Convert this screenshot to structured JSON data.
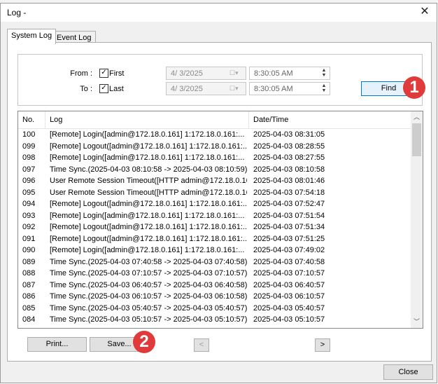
{
  "window": {
    "title": "Log -"
  },
  "tabs": [
    {
      "label": "System Log"
    },
    {
      "label": "Event Log"
    }
  ],
  "filter": {
    "from_label": "From :",
    "to_label": "To :",
    "first_label": "First",
    "last_label": "Last",
    "first_checked": true,
    "last_checked": true,
    "from_date": "4/  3/2025",
    "to_date": "4/  3/2025",
    "from_time": "8:30:05 AM",
    "to_time": "8:30:05 AM",
    "find_label": "Find"
  },
  "table": {
    "columns": [
      "No.",
      "Log",
      "Date/Time"
    ],
    "rows": [
      {
        "no": "100",
        "log": "[Remote] Login([admin@172.18.0.161] 1:172.18.0.161:...",
        "dt": "2025-04-03 08:31:05"
      },
      {
        "no": "099",
        "log": "[Remote] Logout([admin@172.18.0.161] 1:172.18.0.161:...",
        "dt": "2025-04-03 08:28:55"
      },
      {
        "no": "098",
        "log": "[Remote] Login([admin@172.18.0.161] 1:172.18.0.161:...",
        "dt": "2025-04-03 08:27:55"
      },
      {
        "no": "097",
        "log": "Time Sync.(2025-04-03 08:10:58 -> 2025-04-03 08:10:59)",
        "dt": "2025-04-03 08:10:58"
      },
      {
        "no": "096",
        "log": "User Remote Session Timeout([HTTP admin@172.18.0.16...",
        "dt": "2025-04-03 08:01:46"
      },
      {
        "no": "095",
        "log": "User Remote Session Timeout([HTTP admin@172.18.0.16...",
        "dt": "2025-04-03 07:54:18"
      },
      {
        "no": "094",
        "log": "[Remote] Logout([admin@172.18.0.161] 1:172.18.0.161:...",
        "dt": "2025-04-03 07:52:47"
      },
      {
        "no": "093",
        "log": "[Remote] Login([admin@172.18.0.161] 1:172.18.0.161:...",
        "dt": "2025-04-03 07:51:54"
      },
      {
        "no": "092",
        "log": "[Remote] Logout([admin@172.18.0.161] 1:172.18.0.161:...",
        "dt": "2025-04-03 07:51:34"
      },
      {
        "no": "091",
        "log": "[Remote] Logout([admin@172.18.0.161] 1:172.18.0.161:...",
        "dt": "2025-04-03 07:51:25"
      },
      {
        "no": "090",
        "log": "[Remote] Login([admin@172.18.0.161] 1:172.18.0.161:...",
        "dt": "2025-04-03 07:49:02"
      },
      {
        "no": "089",
        "log": "Time Sync.(2025-04-03 07:40:58 -> 2025-04-03 07:40:58)",
        "dt": "2025-04-03 07:40:58"
      },
      {
        "no": "088",
        "log": "Time Sync.(2025-04-03 07:10:57 -> 2025-04-03 07:10:57)",
        "dt": "2025-04-03 07:10:57"
      },
      {
        "no": "087",
        "log": "Time Sync.(2025-04-03 06:40:57 -> 2025-04-03 06:40:58)",
        "dt": "2025-04-03 06:40:57"
      },
      {
        "no": "086",
        "log": "Time Sync.(2025-04-03 06:10:57 -> 2025-04-03 06:10:58)",
        "dt": "2025-04-03 06:10:57"
      },
      {
        "no": "085",
        "log": "Time Sync.(2025-04-03 05:40:57 -> 2025-04-03 05:40:57)",
        "dt": "2025-04-03 05:40:57"
      },
      {
        "no": "084",
        "log": "Time Sync.(2025-04-03 05:10:57 -> 2025-04-03 05:10:57)",
        "dt": "2025-04-03 05:10:57"
      }
    ]
  },
  "buttons": {
    "print": "Print...",
    "save": "Save...",
    "prev": "<",
    "next": ">",
    "close": "Close"
  },
  "annotations": {
    "badge1": "1",
    "badge2": "2"
  },
  "icons": {
    "close": "close-icon",
    "calendar": "calendar-dropdown-icon",
    "spin_up": "spin-up-icon",
    "spin_down": "spin-down-icon"
  },
  "colors": {
    "badge": "#e03a3a",
    "focus": "#0078d7"
  }
}
